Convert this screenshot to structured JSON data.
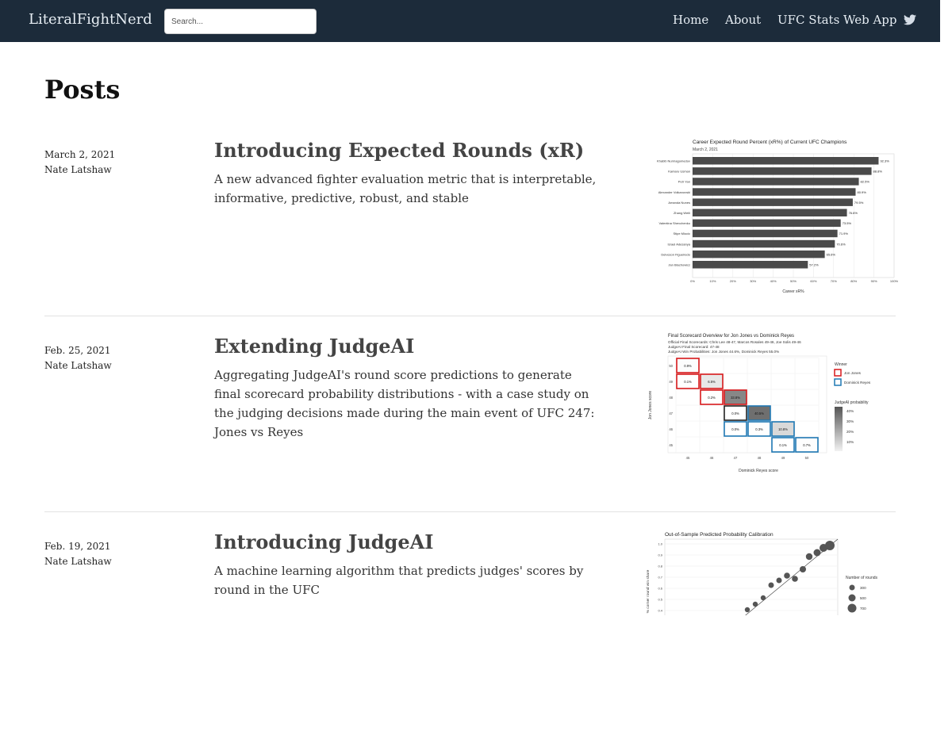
{
  "nav": {
    "brand": "LiteralFightNerd",
    "search_placeholder": "Search...",
    "links": [
      "Home",
      "About",
      "UFC Stats Web App"
    ],
    "social_icon": "twitter-icon"
  },
  "page_title": "Posts",
  "posts": [
    {
      "date": "March 2, 2021",
      "author": "Nate Latshaw",
      "title": "Introducing Expected Rounds (xR)",
      "description": "A new advanced fighter evaluation metric that is interpretable, informative, predictive, robust, and stable",
      "thumbnail": {
        "title": "Career Expected Round Percent (xR%) of Current UFC Champions",
        "subtitle": "March 2, 2021",
        "xlabel": "Career xR%",
        "ticks": [
          "0%",
          "10%",
          "20%",
          "30%",
          "40%",
          "50%",
          "60%",
          "70%",
          "80%",
          "90%",
          "100%"
        ],
        "fighters": [
          "Khabib Nurmagomedov",
          "Kamaru Usman",
          "Petr Yan",
          "Alexander Volkanovski",
          "Amanda Nunes",
          "Zhang Weili",
          "Valentina Shevchenko",
          "Stipe Miocic",
          "Israel Adesanya",
          "Deiveson Figueiredo",
          "Jan Blachowicz"
        ],
        "values": [
          92.3,
          88.8,
          82.5,
          80.9,
          79.5,
          76.6,
          73.5,
          71.9,
          70.6,
          65.6,
          57.2
        ],
        "value_labels": [
          "92.3%",
          "88.8%",
          "82.5%",
          "80.9%",
          "79.5%",
          "76.6%",
          "73.5%",
          "71.9%",
          "70.6%",
          "65.6%",
          "57.2%"
        ]
      }
    },
    {
      "date": "Feb. 25, 2021",
      "author": "Nate Latshaw",
      "title": "Extending JudgeAI",
      "description": "Aggregating JudgeAI's round score predictions to generate final scorecard probability distributions - with a case study on the judging decisions made during the main event of UFC 247: Jones vs Reyes",
      "thumbnail": {
        "title": "Final Scorecard Overview for Jon Jones vs Dominick Reyes",
        "lines": [
          "Official Final Scorecards: Chris Lee 48-47, Marcos Rosales 49-46, Joe Solis 49-46",
          "JudgeAI Final Scorecard: 47-48",
          "JudgeAI Win Probabilities: Jon Jones 44.6%, Dominick Reyes 55.0%"
        ],
        "xlabel": "Dominick Reyes score",
        "ylabel": "Jon Jones score",
        "axis": [
          "45",
          "46",
          "47",
          "48",
          "49",
          "50"
        ],
        "legend_winner_title": "Winner",
        "legend_winner": [
          "Jon Jones",
          "Dominick Reyes"
        ],
        "legend_prob_title": "JudgeAI probability",
        "legend_prob": [
          "40%",
          "30%",
          "20%",
          "10%"
        ],
        "colors": {
          "jones": "#d7191c",
          "reyes": "#1f78b4"
        },
        "cells": [
          {
            "label": "0.9%",
            "winner": "jones"
          },
          {
            "label": "0.1%",
            "winner": "jones"
          },
          {
            "label": "6.5%",
            "winner": "jones"
          },
          {
            "label": "0.2%",
            "winner": "jones"
          },
          {
            "label": "33.8%",
            "winner": "jones"
          },
          {
            "label": "0.0%",
            "winner": "none"
          },
          {
            "label": "40.5%",
            "winner": "reyes"
          },
          {
            "label": "0.0%",
            "winner": "reyes"
          },
          {
            "label": "0.3%",
            "winner": "reyes"
          },
          {
            "label": "10.8%",
            "winner": "reyes"
          },
          {
            "label": "0.1%",
            "winner": "reyes"
          },
          {
            "label": "0.7%",
            "winner": "reyes"
          }
        ]
      }
    },
    {
      "date": "Feb. 19, 2021",
      "author": "Nate Latshaw",
      "title": "Introducing JudgeAI",
      "description": "A machine learning algorithm that predicts judges' scores by round in the UFC",
      "thumbnail": {
        "title": "Out-of-Sample Predicted Probability Calibration",
        "ylabel": "% corner round win share",
        "yticks": [
          "1.0",
          "0.9",
          "0.8",
          "0.7",
          "0.6",
          "0.5",
          "0.4"
        ],
        "legend_title": "Number of rounds",
        "legend": [
          "300",
          "500",
          "700"
        ]
      }
    }
  ]
}
